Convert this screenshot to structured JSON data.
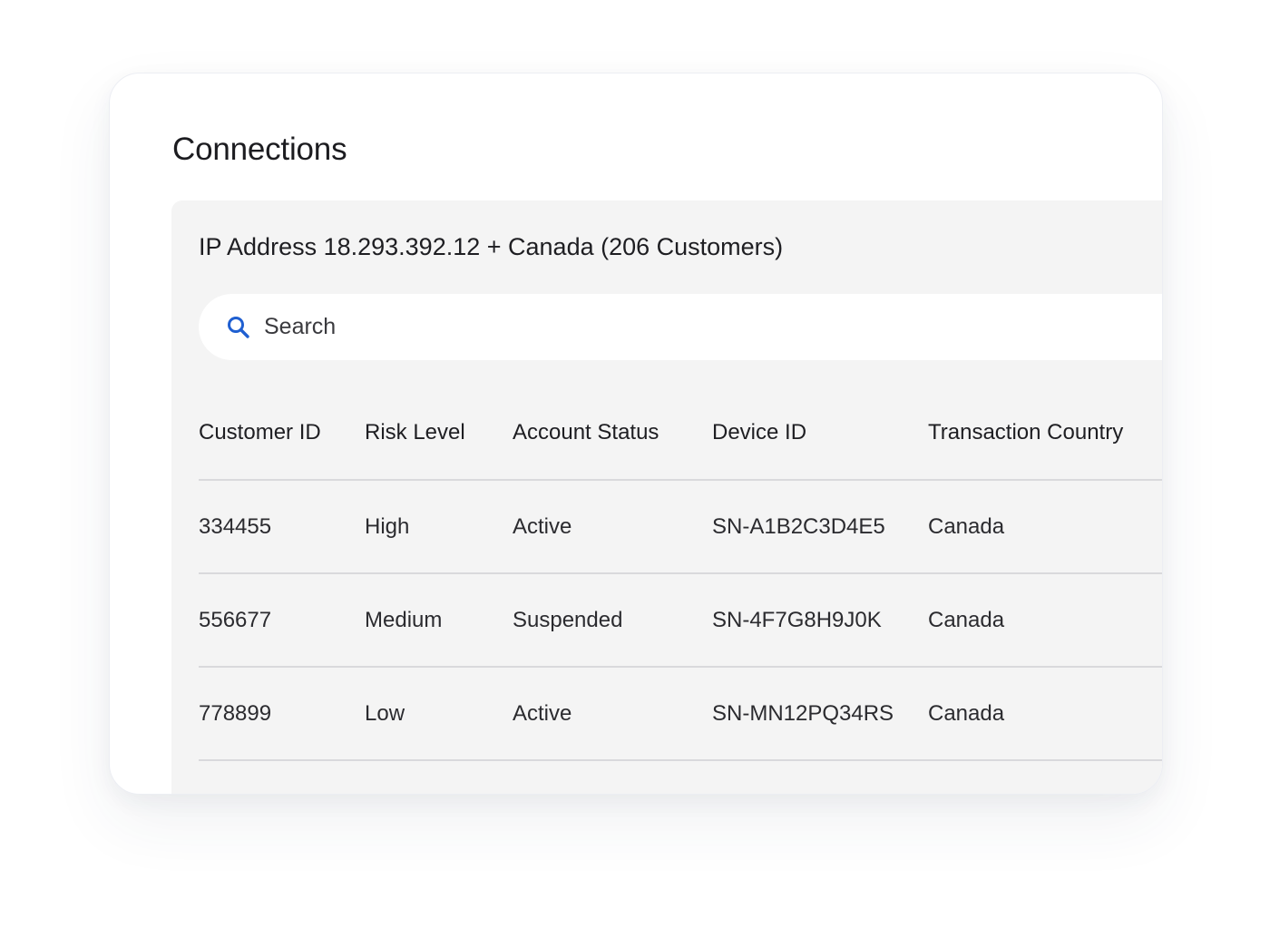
{
  "page": {
    "title": "Connections"
  },
  "panel": {
    "title": "IP Address 18.293.392.12 + Canada (206 Customers)"
  },
  "search": {
    "placeholder": "Search",
    "value": "",
    "icon": "search-icon",
    "icon_color": "#1f5fd1"
  },
  "table": {
    "columns": [
      "Customer ID",
      "Risk Level",
      "Account Status",
      "Device ID",
      "Transaction Country"
    ],
    "rows": [
      [
        "334455",
        "High",
        "Active",
        "SN-A1B2C3D4E5",
        "Canada"
      ],
      [
        "556677",
        "Medium",
        "Suspended",
        "SN-4F7G8H9J0K",
        "Canada"
      ],
      [
        "778899",
        "Low",
        "Active",
        "SN-MN12PQ34RS",
        "Canada"
      ]
    ]
  }
}
